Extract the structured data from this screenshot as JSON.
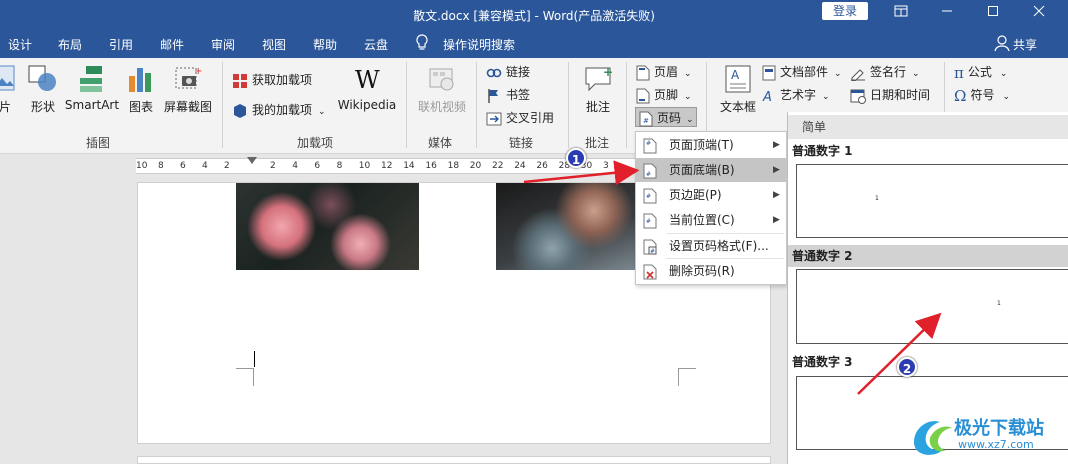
{
  "titlebar": {
    "title": "散文.docx [兼容模式] - Word(产品激活失败)",
    "login": "登录",
    "window_buttons": [
      "ribbon-display-icon",
      "minimize-icon",
      "maximize-icon",
      "close-icon"
    ]
  },
  "tabs": {
    "design": "设计",
    "layout": "布局",
    "references": "引用",
    "mailings": "邮件",
    "review": "审阅",
    "view": "视图",
    "help": "帮助",
    "cloud": "云盘",
    "tell_me": "操作说明搜索",
    "share": "共享"
  },
  "ribbon": {
    "illustrations": {
      "picture": "片",
      "shapes": "形状",
      "smartart": "SmartArt",
      "chart": "图表",
      "screenshot": "屏幕截图",
      "label": "插图"
    },
    "addins": {
      "get_addins": "获取加载项",
      "my_addins": "我的加载项",
      "wikipedia": "Wikipedia",
      "label": "加载项"
    },
    "media": {
      "online_video": "联机视频",
      "label": "媒体"
    },
    "links": {
      "link": "链接",
      "bookmark": "书签",
      "cross_ref": "交叉引用",
      "label": "链接"
    },
    "comments": {
      "comment": "批注",
      "label": "批注"
    },
    "header_footer": {
      "header": "页眉",
      "footer": "页脚",
      "page_number": "页码"
    },
    "text": {
      "textbox": "文本框",
      "quick_parts": "文档部件",
      "wordart": "艺术字",
      "signature": "签名行",
      "datetime": "日期和时间"
    },
    "symbols": {
      "equation": "公式",
      "symbol": "符号"
    }
  },
  "ruler": {
    "numbers": [
      "10",
      "8",
      "6",
      "4",
      "2",
      "2",
      "4",
      "6",
      "8",
      "10",
      "12",
      "14",
      "16",
      "18",
      "20",
      "22",
      "24",
      "26",
      "28",
      "30",
      "3"
    ]
  },
  "page_number_menu": {
    "items": [
      {
        "label": "页面顶端(T)",
        "has_submenu": true
      },
      {
        "label": "页面底端(B)",
        "has_submenu": true,
        "highlighted": true
      },
      {
        "label": "页边距(P)",
        "has_submenu": true
      },
      {
        "label": "当前位置(C)",
        "has_submenu": true
      },
      {
        "label": "设置页码格式(F)...",
        "has_submenu": false
      },
      {
        "label": "删除页码(R)",
        "has_submenu": false
      }
    ]
  },
  "gallery": {
    "header": "简单",
    "items": [
      {
        "title": "普通数字 1",
        "number": "1",
        "selected": false
      },
      {
        "title": "普通数字 2",
        "number": "1",
        "selected": true
      },
      {
        "title": "普通数字 3",
        "number": "",
        "selected": false
      }
    ]
  },
  "annotations": {
    "badge1": "1",
    "badge2": "2",
    "arrow_color": "#e0202a",
    "badge_color": "#2b3bb0"
  },
  "colors": {
    "word_blue": "#2b579a",
    "ribbon_bg": "#f3f3f3"
  },
  "watermark": {
    "title": "极光下载站",
    "url": "www.xz7.com"
  }
}
